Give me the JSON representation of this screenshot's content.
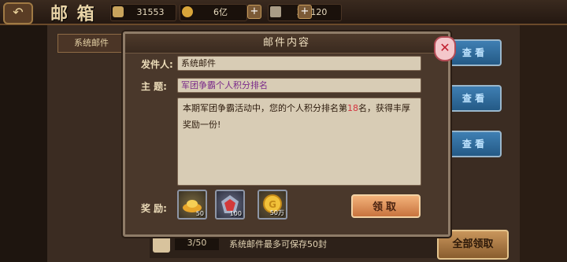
{
  "header": {
    "back_icon": "back-arrow-icon",
    "title": "邮 箱",
    "resources": [
      {
        "icon": "coin-stack-icon",
        "value": "31553",
        "color": "#c9a45c"
      },
      {
        "icon": "gold-coin-icon",
        "value": "6亿",
        "color": "#d9a63a"
      },
      {
        "icon": "troop-flag-icon",
        "value": "30/120",
        "color": "#a99c86"
      }
    ]
  },
  "sidebar": {
    "tab_label": "系统邮件"
  },
  "mail_list": {
    "view_label": "查 看",
    "count": "3/50",
    "note": "系统邮件最多可保存50封",
    "collect_all_label": "全部领取"
  },
  "modal": {
    "title": "邮件内容",
    "sender_label": "发件人:",
    "sender_value": "系统邮件",
    "subject_label": "主  题:",
    "subject_value": "军团争霸个人积分排名",
    "content_before": "本期军团争霸活动中，您的个人积分排名第",
    "content_rank": "18",
    "content_after": "名，获得丰厚奖励一份!",
    "reward_label": "奖  励:",
    "rewards": [
      {
        "icon": "gold-ingot-icon",
        "qty": "50"
      },
      {
        "icon": "red-gem-icon",
        "qty": "100"
      },
      {
        "icon": "gold-coin-icon",
        "qty": "50万"
      }
    ],
    "claim_label": "领取",
    "close_icon": "close-x-icon"
  },
  "colors": {
    "highlight": "#d3333f",
    "subject_text": "#7a2a8a",
    "accent": "#c8733e"
  }
}
